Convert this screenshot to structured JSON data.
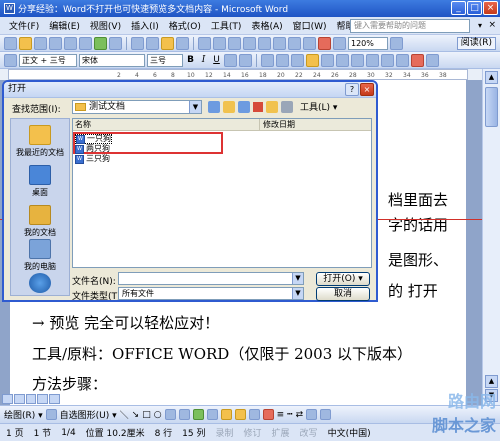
{
  "window": {
    "title": "分享经验：Word不打开也可快速预览多文档内容 - Microsoft Word"
  },
  "menu": {
    "items": [
      "文件(F)",
      "编辑(E)",
      "视图(V)",
      "插入(I)",
      "格式(O)",
      "工具(T)",
      "表格(A)",
      "窗口(W)",
      "帮助(H)"
    ],
    "ask_placeholder": "键入需要帮助的问题"
  },
  "toolbar": {
    "zoom": "120%",
    "read_button": "阅读(R)"
  },
  "format_toolbar": {
    "style": "正文 + 三号",
    "font": "宋体",
    "size": "三号"
  },
  "ruler": {
    "marks": [
      "2",
      "4",
      "6",
      "8",
      "10",
      "12",
      "14",
      "16",
      "18",
      "20",
      "22",
      "24",
      "26",
      "28",
      "30",
      "32",
      "34",
      "36",
      "38"
    ]
  },
  "document": {
    "line1_right": "档里面去",
    "line2_right": "字的话用",
    "line3_right": "是图形、",
    "line4_right": "的 打开",
    "line5": "→ 预览 完全可以轻松应对！",
    "line6": "工具/原料：OFFICE WORD（仅限于 2003 以下版本）",
    "line7": "方法步骤："
  },
  "dialog": {
    "title": "打开",
    "look_in_label": "查找范围(I):",
    "look_in_value": "测试文档",
    "tools_label": "工具(L) ▾",
    "places": [
      "我最近的文档",
      "桌面",
      "我的文档",
      "我的电脑",
      ""
    ],
    "columns": [
      "名称",
      "修改日期"
    ],
    "files": [
      "一只狗",
      "两只狗",
      "三只狗"
    ],
    "filename_label": "文件名(N):",
    "filename_value": "",
    "filetype_label": "文件类型(T):",
    "filetype_value": "所有文件",
    "open_button": "打开(O) ▾",
    "cancel_button": "取消"
  },
  "drawbar": {
    "draw_label": "绘图(R) ▾",
    "autoshapes_label": "自选图形(U) ▾"
  },
  "status": {
    "page": "1 页",
    "section": "1 节",
    "page_of": "1/4",
    "position": "位置 10.2厘米",
    "line": "8 行",
    "column": "15 列",
    "rec": "录制",
    "trk": "修订",
    "ext": "扩展",
    "ovr": "改写",
    "lang": "中文(中国)"
  },
  "watermark": {
    "line1": "路由网",
    "line2": "脚本之家"
  },
  "colors": {
    "title_blue": "#1f54c4",
    "annotation_red": "#d33333",
    "dialog_bg": "#ece9d8"
  }
}
